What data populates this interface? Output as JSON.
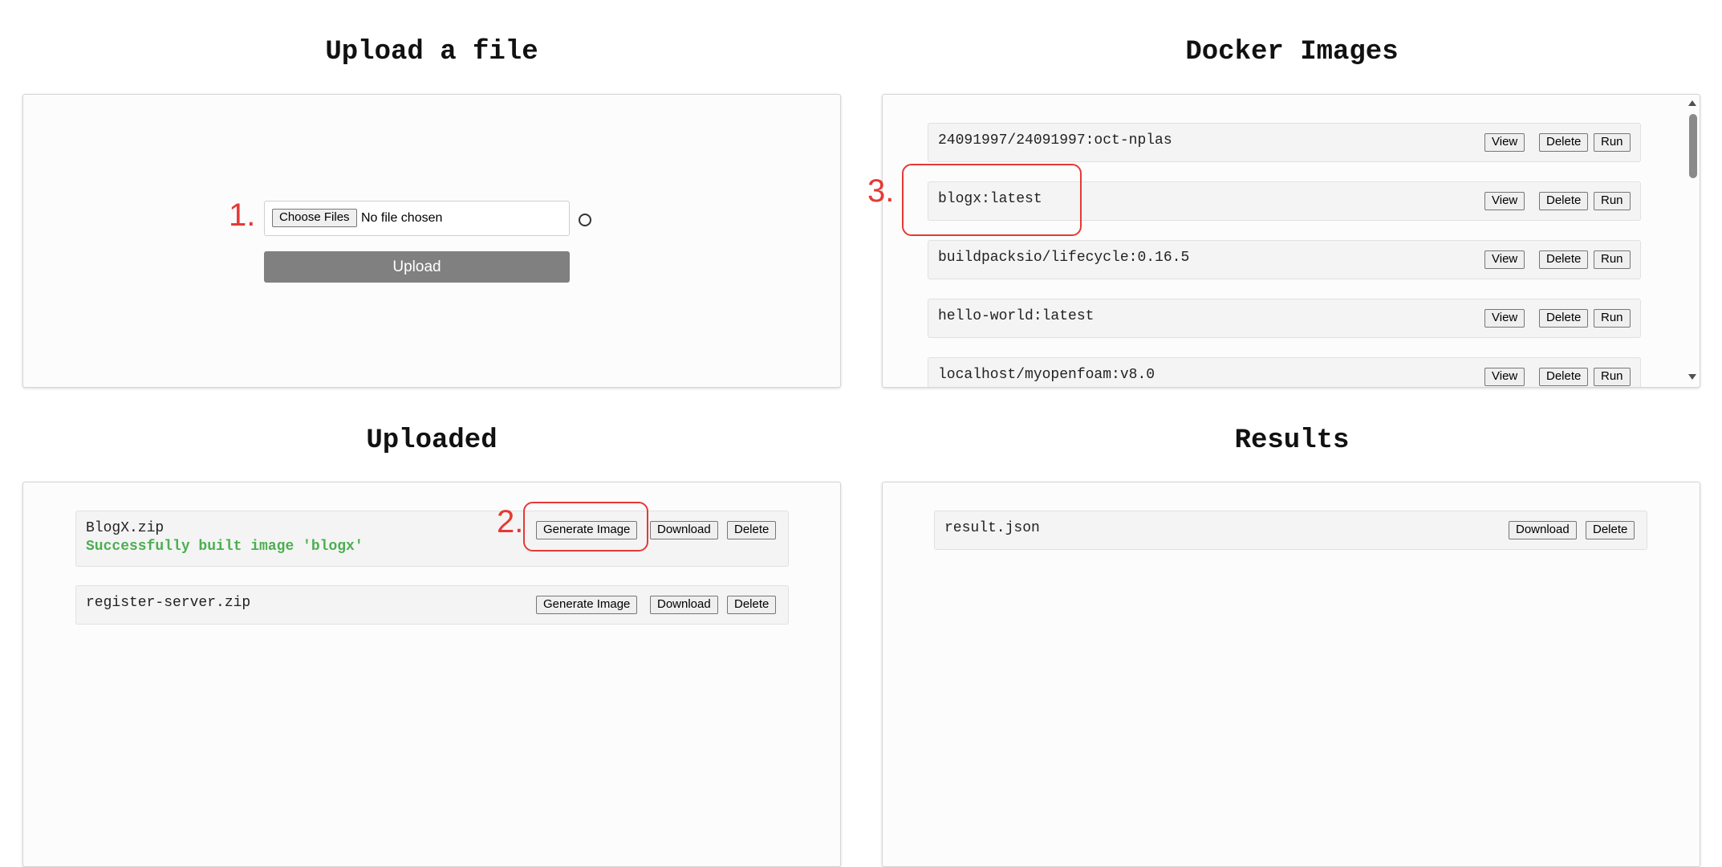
{
  "upload": {
    "title": "Upload a file",
    "choose_files_label": "Choose Files",
    "no_file_text": "No file chosen",
    "upload_button": "Upload"
  },
  "docker": {
    "title": "Docker Images",
    "images": [
      {
        "name": "24091997/24091997:oct-nplas"
      },
      {
        "name": "blogx:latest"
      },
      {
        "name": "buildpacksio/lifecycle:0.16.5"
      },
      {
        "name": "hello-world:latest"
      },
      {
        "name": "localhost/myopenfoam:v8.0"
      }
    ],
    "view_label": "View",
    "delete_label": "Delete",
    "run_label": "Run"
  },
  "uploaded": {
    "title": "Uploaded",
    "files": [
      {
        "name": "BlogX.zip",
        "status": "Successfully built image 'blogx'"
      },
      {
        "name": "register-server.zip"
      }
    ],
    "generate_label": "Generate Image",
    "download_label": "Download",
    "delete_label": "Delete"
  },
  "results": {
    "title": "Results",
    "files": [
      {
        "name": "result.json"
      }
    ],
    "download_label": "Download",
    "delete_label": "Delete"
  },
  "annotations": {
    "one": "1.",
    "two": "2.",
    "three": "3.",
    "color": "#e53935"
  },
  "colors": {
    "success_text": "#4caf50",
    "upload_button_bg": "#808080"
  }
}
